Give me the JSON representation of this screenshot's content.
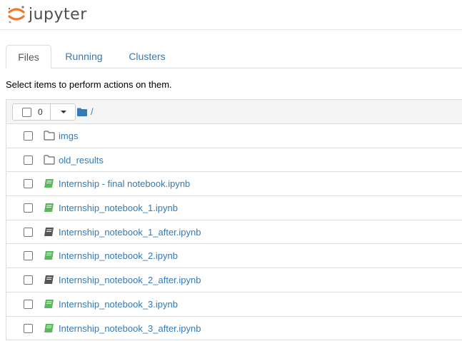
{
  "app": {
    "logo_text": "jupyter"
  },
  "tabs": [
    {
      "label": "Files",
      "active": true
    },
    {
      "label": "Running",
      "active": false
    },
    {
      "label": "Clusters",
      "active": false
    }
  ],
  "hint": "Select items to perform actions on them.",
  "selection": {
    "count": "0"
  },
  "breadcrumb": {
    "path": "/"
  },
  "colors": {
    "link": "#337ab7",
    "notebook_green": "#5cb85c",
    "notebook_dark": "#555555"
  },
  "files": [
    {
      "name": "imgs",
      "type": "folder",
      "icon": "folder-icon"
    },
    {
      "name": "old_results",
      "type": "folder",
      "icon": "folder-icon"
    },
    {
      "name": "Internship - final notebook.ipynb",
      "type": "notebook",
      "running": true,
      "icon": "notebook-icon"
    },
    {
      "name": "Internship_notebook_1.ipynb",
      "type": "notebook",
      "running": true,
      "icon": "notebook-icon"
    },
    {
      "name": "Internship_notebook_1_after.ipynb",
      "type": "notebook",
      "running": false,
      "icon": "notebook-icon"
    },
    {
      "name": "Internship_notebook_2.ipynb",
      "type": "notebook",
      "running": true,
      "icon": "notebook-icon"
    },
    {
      "name": "Internship_notebook_2_after.ipynb",
      "type": "notebook",
      "running": false,
      "icon": "notebook-icon"
    },
    {
      "name": "Internship_notebook_3.ipynb",
      "type": "notebook",
      "running": true,
      "icon": "notebook-icon"
    },
    {
      "name": "Internship_notebook_3_after.ipynb",
      "type": "notebook",
      "running": true,
      "icon": "notebook-icon"
    }
  ]
}
